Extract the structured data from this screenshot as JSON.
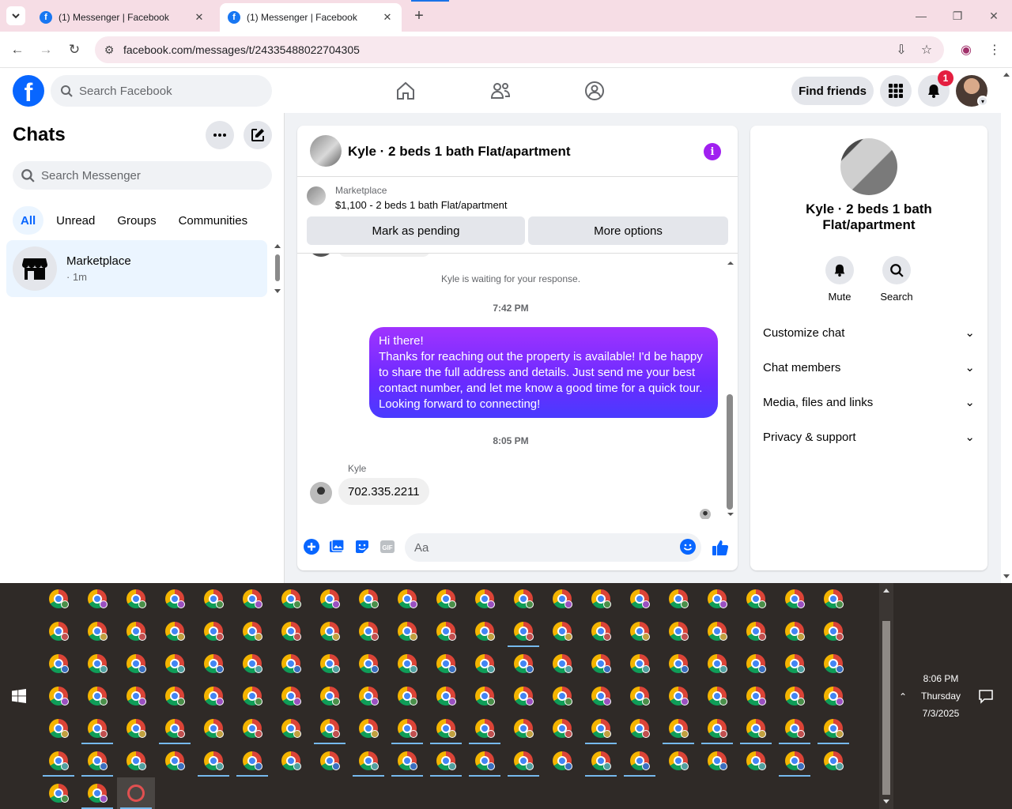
{
  "browser": {
    "tabs": [
      {
        "title": "(1) Messenger | Facebook",
        "active": false
      },
      {
        "title": "(1) Messenger | Facebook",
        "active": true
      }
    ],
    "url": "facebook.com/messages/t/24335488022704305"
  },
  "fb_header": {
    "logo": "f",
    "search_placeholder": "Search Facebook",
    "find_friends": "Find friends",
    "notification_count": "1"
  },
  "sidebar": {
    "title": "Chats",
    "search_placeholder": "Search Messenger",
    "filters": [
      "All",
      "Unread",
      "Groups",
      "Communities"
    ],
    "active_filter": "All",
    "chats": [
      {
        "name": "Marketplace",
        "meta": "· 1m"
      }
    ]
  },
  "conversation": {
    "title": "Kyle · 2 beds 1 bath Flat/apartment",
    "marketplace_label": "Marketplace",
    "listing": "$1,100 - 2 beds 1 bath Flat/apartment",
    "mark_pending": "Mark as pending",
    "more_options": "More options",
    "waiting_note": "Kyle is waiting for your response.",
    "time_1": "7:42 PM",
    "outgoing_message": "Hi there!\nThanks for reaching out the property is available! I'd be happy to share the full address and details. Just send me your best contact number, and let me know a good time for a quick tour. Looking forward to connecting!",
    "time_2": "8:05 PM",
    "sender_name": "Kyle",
    "incoming_message": "702.335.2211",
    "composer_placeholder": "Aa"
  },
  "info_panel": {
    "name": "Kyle · 2 beds 1 bath Flat/apartment",
    "actions": [
      "Mute",
      "Search"
    ],
    "sections": [
      "Customize chat",
      "Chat members",
      "Media, files and links",
      "Privacy & support"
    ]
  },
  "taskbar": {
    "time": "8:06 PM",
    "day": "Thursday",
    "date": "7/3/2025"
  },
  "colors": {
    "brand": "#0866ff",
    "outgoing_bubble": "#7b2bff",
    "info_accent": "#a020f0",
    "badge": "#e41e3f"
  }
}
